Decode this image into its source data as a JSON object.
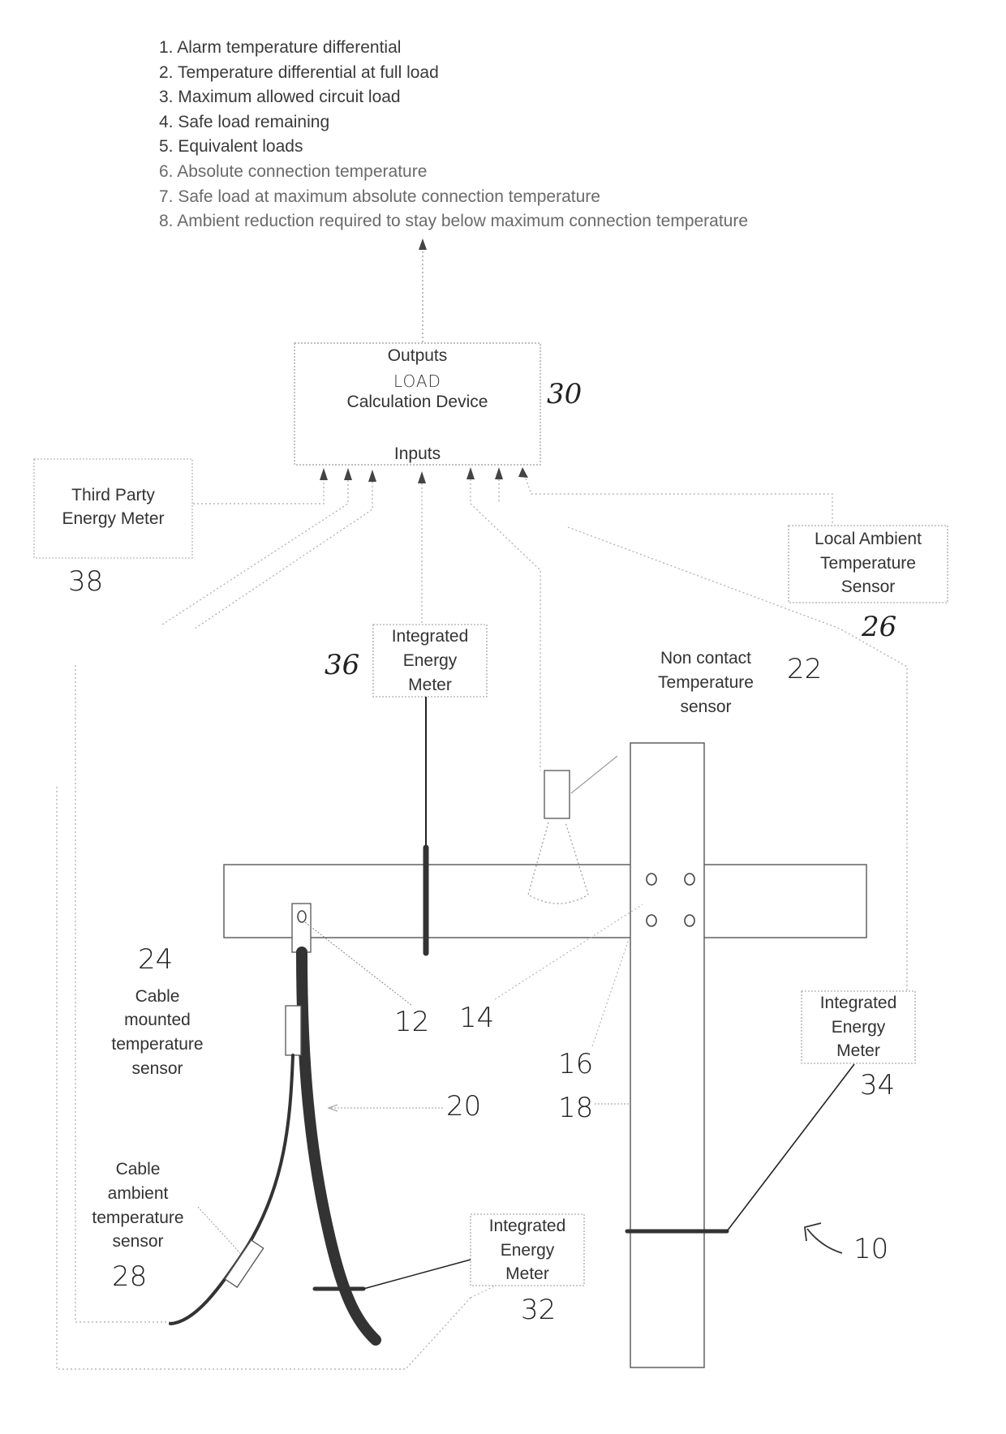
{
  "outputs_list": [
    "1. Alarm temperature differential",
    "2. Temperature differential at full load",
    "3. Maximum allowed circuit load",
    "4. Safe load remaining",
    "5. Equivalent loads",
    "6. Absolute connection temperature",
    "7. Safe load at maximum absolute connection temperature",
    "8. Ambient reduction required to stay below maximum connection temperature"
  ],
  "calc_device": {
    "outputs_label": "Outputs",
    "handwritten_word": "LOAD",
    "title": "Calculation Device",
    "inputs_label": "Inputs",
    "ref": "30"
  },
  "third_party_meter": {
    "line1": "Third Party",
    "line2": "Energy Meter",
    "ref": "38"
  },
  "local_ambient_sensor": {
    "line1": "Local Ambient",
    "line2": "Temperature",
    "line3": "Sensor",
    "ref": "26"
  },
  "integrated_meter_36": {
    "line1": "Integrated",
    "line2": "Energy",
    "line3": "Meter",
    "ref": "36"
  },
  "non_contact_sensor": {
    "line1": "Non contact",
    "line2": "Temperature",
    "line3": "sensor",
    "ref": "22"
  },
  "cable_mounted_sensor": {
    "line1": "Cable",
    "line2": "mounted",
    "line3": "temperature",
    "line4": "sensor",
    "ref": "24"
  },
  "cable_ambient_sensor": {
    "line1": "Cable",
    "line2": "ambient",
    "line3": "temperature",
    "line4": "sensor",
    "ref": "28"
  },
  "integrated_meter_34": {
    "line1": "Integrated",
    "line2": "Energy",
    "line3": "Meter",
    "ref": "34"
  },
  "integrated_meter_32": {
    "line1": "Integrated",
    "line2": "Energy",
    "line3": "Meter",
    "ref": "32"
  },
  "refs": {
    "lug": "12",
    "connection": "14",
    "bolt": "16",
    "busbar": "18",
    "cable": "20",
    "system": "10"
  }
}
